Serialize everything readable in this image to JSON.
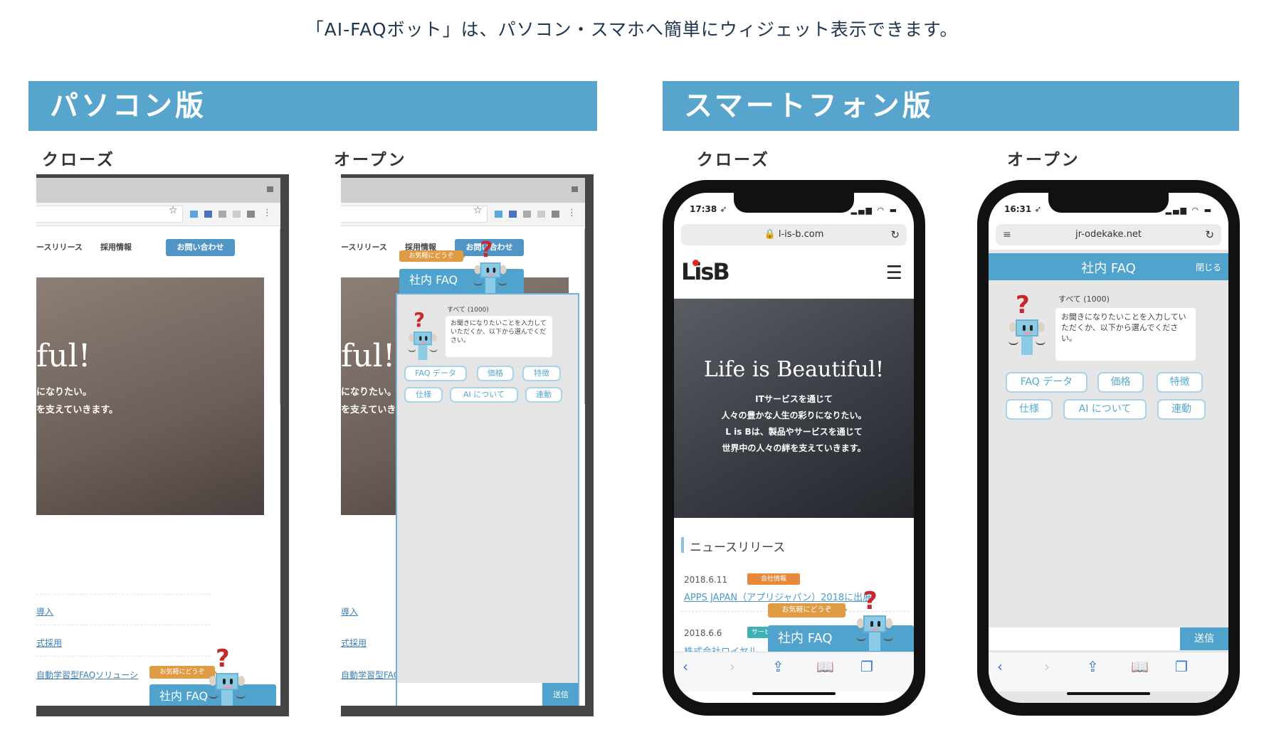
{
  "title": "「AI-FAQボット」は、パソコン・スマホへ簡単にウィジェット表示できます。",
  "pc": {
    "heading": "パソコン版",
    "close_label": "クローズ",
    "open_label": "オープン",
    "nav": [
      "ースリリース",
      "採用情報",
      "お問い合わせ"
    ],
    "hero_title": "ful!",
    "hero_lines": [
      "になりたい。",
      "を支えていきます。"
    ],
    "list": [
      "導入",
      "式採用",
      "自動学習型FAQソリューシ"
    ],
    "bubble": "お気軽にどうぞ",
    "faq_tab": "社内 FAQ",
    "widget": {
      "count": "すべて (1000)",
      "message": "お聞きになりたいことを入力していただくか、以下から選んでください。",
      "chips": [
        "FAQ データ",
        "価格",
        "特徴",
        "仕様",
        "AI について",
        "連動"
      ],
      "send": "送信"
    }
  },
  "sp": {
    "heading": "スマートフォン版",
    "close_label": "クローズ",
    "open_label": "オープン",
    "close": {
      "time": "17:38 ➶",
      "url": "🔒 l-is-b.com",
      "logo": "LisB",
      "hero_title": "Life is Beautiful!",
      "hero_lines": [
        "ITサービスを通じて",
        "人々の豊かな人生の彩りになりたい。",
        "L is Bは、製品やサービスを通じて",
        "世界中の人々の絆を支えていきます。"
      ],
      "news_heading": "ニュースリリース",
      "news": [
        {
          "date": "2018.6.11",
          "tag": "会社情報",
          "tag_color": "#e8883a",
          "title": "APPS JAPAN（アプリジャパン）2018に出展"
        },
        {
          "date": "2018.6.6",
          "tag": "サービス",
          "tag_color": "#3fb0b5",
          "title": "株式会社ロイヤル..."
        }
      ],
      "bubble": "お気軽にどうぞ",
      "faq_tab": "社内 FAQ"
    },
    "open": {
      "time": "16:31 ➶",
      "url": "jr-odekake.net",
      "header": "社内 FAQ",
      "close_button": "閉じる",
      "count": "すべて (1000)",
      "message": "お聞きになりたいことを入力していただくか、以下から選んでください。",
      "chips": [
        "FAQ データ",
        "価格",
        "特徴",
        "仕様",
        "AI について",
        "連動"
      ],
      "send": "送信"
    }
  },
  "colors": {
    "accent": "#57a5cc",
    "bubble": "#e09b45",
    "robot_q": "#c7282b"
  }
}
